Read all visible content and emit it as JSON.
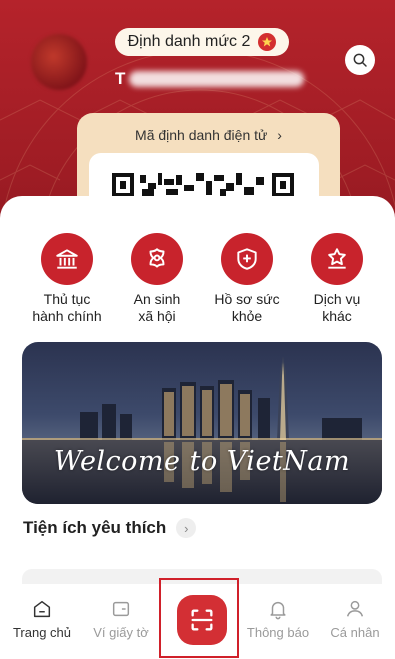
{
  "header": {
    "level_label": "Định danh mức 2",
    "user_name_visible": "T",
    "id_link_label": "Mã định danh điện tử",
    "id_link_chevron": "›"
  },
  "services": [
    {
      "label_line1": "Thủ tục",
      "label_line2": "hành chính",
      "icon": "government-building-icon"
    },
    {
      "label_line1": "An sinh",
      "label_line2": "xã hội",
      "icon": "social-welfare-icon"
    },
    {
      "label_line1": "Hồ sơ sức",
      "label_line2": "khỏe",
      "icon": "health-shield-icon"
    },
    {
      "label_line1": "Dịch vụ",
      "label_line2": "khác",
      "icon": "other-services-icon"
    }
  ],
  "banner": {
    "text": "Welcome to VietNam"
  },
  "favorites": {
    "title": "Tiện ích yêu thích",
    "arrow": "›"
  },
  "nav": [
    {
      "label": "Trang chủ",
      "icon": "home-icon",
      "active": true
    },
    {
      "label": "Ví giấy tờ",
      "icon": "wallet-icon",
      "active": false
    },
    {
      "label": "Thông báo",
      "icon": "bell-icon",
      "active": false
    },
    {
      "label": "Cá nhân",
      "icon": "user-icon",
      "active": false
    }
  ],
  "colors": {
    "brand_red": "#c8232c",
    "header_red": "#a51e26",
    "card_beige": "#f5dfbf",
    "highlight_border": "#d0202a"
  }
}
